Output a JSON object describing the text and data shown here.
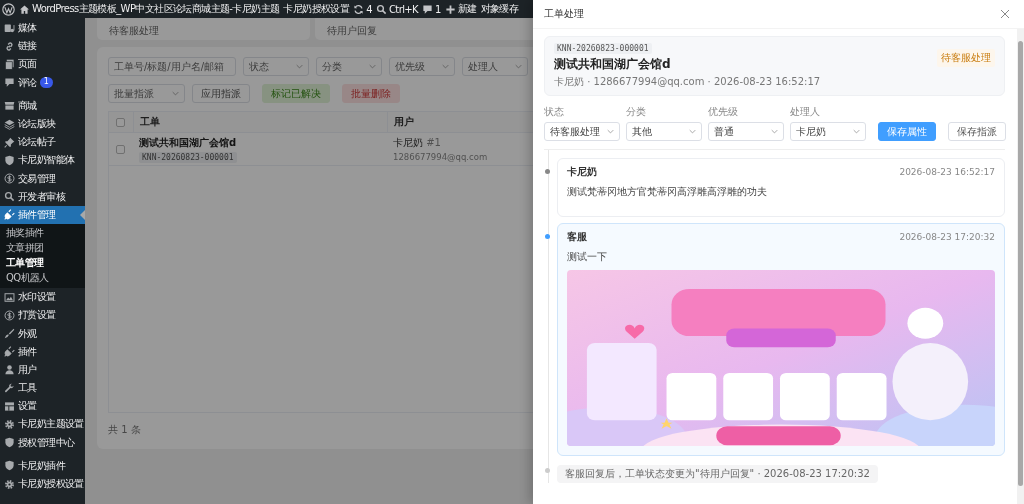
{
  "admin_bar": {
    "items": [
      {
        "kind": "logo"
      },
      {
        "kind": "home",
        "label": "WordPress主题模板_WP中文社区论坛商城主题-卡尼奶主题"
      },
      {
        "kind": "text",
        "label": "卡尼奶授权设置"
      },
      {
        "kind": "sync",
        "label": "4"
      },
      {
        "kind": "search",
        "label": "Ctrl+K"
      },
      {
        "kind": "comment",
        "label": "1"
      },
      {
        "kind": "plus",
        "label": "新建"
      },
      {
        "kind": "text",
        "label": "对象缓存"
      }
    ]
  },
  "sidebar": {
    "groups": [
      {
        "items": [
          {
            "label": "媒体",
            "selected": false
          },
          {
            "label": "链接",
            "selected": false
          },
          {
            "label": "页面",
            "selected": false
          },
          {
            "label": "评论",
            "selected": false,
            "badge": "1"
          }
        ]
      },
      {
        "items": [
          {
            "label": "商城",
            "selected": false
          },
          {
            "label": "论坛版块",
            "selected": false
          },
          {
            "label": "论坛帖子",
            "selected": false
          },
          {
            "label": "卡尼奶智能体",
            "selected": false
          },
          {
            "label": "交易管理",
            "selected": false
          },
          {
            "label": "开发者审核",
            "selected": false
          },
          {
            "label": "插件管理",
            "selected": true,
            "children": [
              {
                "label": "抽奖插件",
                "selected": false
              },
              {
                "label": "文章拼团",
                "selected": false
              },
              {
                "label": "工单管理",
                "selected": true
              },
              {
                "label": "QQ机器人",
                "selected": false
              }
            ]
          },
          {
            "label": "水印设置",
            "selected": false
          },
          {
            "label": "打赏设置",
            "selected": false
          },
          {
            "label": "外观",
            "selected": false
          },
          {
            "label": "插件",
            "selected": false
          },
          {
            "label": "用户",
            "selected": false
          },
          {
            "label": "工具",
            "selected": false
          },
          {
            "label": "设置",
            "selected": false
          },
          {
            "label": "卡尼奶主题设置",
            "selected": false
          },
          {
            "label": "授权管理中心",
            "selected": false
          }
        ]
      },
      {
        "items": [
          {
            "label": "卡尼奶插件",
            "selected": false
          },
          {
            "label": "卡尼奶授权设置",
            "selected": false
          }
        ]
      }
    ]
  },
  "stats": [
    {
      "label": "待客服处理"
    },
    {
      "label": "待用户回复"
    }
  ],
  "filters": {
    "search": {
      "placeholder": "工单号/标题/用户名/邮箱"
    },
    "selects": [
      {
        "placeholder": "状态"
      },
      {
        "placeholder": "分类"
      },
      {
        "placeholder": "优先级"
      },
      {
        "placeholder": "处理人"
      }
    ]
  },
  "bulk": {
    "assign": {
      "placeholder": "批量指派"
    },
    "buttons": [
      {
        "label": "应用指派",
        "kind": "default"
      },
      {
        "label": "标记已解决",
        "kind": "success"
      },
      {
        "label": "批量删除",
        "kind": "danger"
      }
    ]
  },
  "table": {
    "columns": [
      "工单",
      "用户"
    ],
    "all_checked": false,
    "rows": [
      {
        "checked": false,
        "title": "测试共和国湖广会馆d",
        "ticket_id": "KNN-20260823-000001",
        "user": "卡尼奶",
        "user_no": "#1",
        "email": "1286677994@qq.com"
      }
    ]
  },
  "footer": "共 1 条",
  "drawer": {
    "title": "工单处理",
    "ticket": {
      "id": "KNN-20260823-000001",
      "title": "测试共和国湖广会馆d",
      "meta": "卡尼奶 · 1286677994@qq.com · 2026-08-23 16:52:17",
      "status": "待客服处理"
    },
    "fields": [
      {
        "label": "状态",
        "value": "待客服处理"
      },
      {
        "label": "分类",
        "value": "其他"
      },
      {
        "label": "优先级",
        "value": "普通"
      },
      {
        "label": "处理人",
        "value": "卡尼奶"
      }
    ],
    "buttons": [
      {
        "label": "保存属性",
        "kind": "primary"
      },
      {
        "label": "保存指派",
        "kind": "default"
      }
    ],
    "timeline": [
      {
        "kind": "user_message",
        "author": "卡尼奶",
        "time": "2026-08-23 16:52:17",
        "text": "测试梵蒂冈地方官梵蒂冈高浮雕高浮雕的功夫"
      },
      {
        "kind": "staff_message",
        "author": "客服",
        "time": "2026-08-23 17:20:32",
        "text": "测试一下"
      },
      {
        "kind": "event",
        "text": "客服回复后，工单状态变更为\"待用户回复\" · 2026-08-23 17:20:32"
      }
    ]
  }
}
